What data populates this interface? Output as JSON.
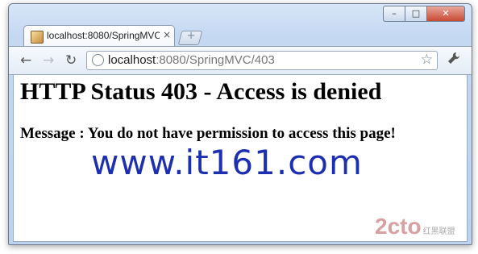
{
  "browser": {
    "tab": {
      "title": "localhost:8080/SpringMVC/",
      "close": "×"
    },
    "new_tab": "+",
    "window_controls": {
      "minimize": "–",
      "maximize": "□",
      "close": "✕"
    },
    "nav": {
      "back": "←",
      "forward": "→",
      "reload": "↻"
    },
    "address": {
      "host": "localhost",
      "rest": ":8080/SpringMVC/403"
    },
    "icons": [
      "page-favicon-icon",
      "globe-icon",
      "star-icon",
      "wrench-icon"
    ],
    "star": "☆",
    "wrench": "🔧"
  },
  "page": {
    "heading": "HTTP Status 403 - Access is denied",
    "message": "Message : You do not have permission to access this page!"
  },
  "watermarks": {
    "site": "www.it161.com",
    "logo": "2cto",
    "logo_sub": "红黑联盟"
  },
  "colors": {
    "watermark_blue": "#1c2fb0",
    "close_button": "#c84a34"
  }
}
